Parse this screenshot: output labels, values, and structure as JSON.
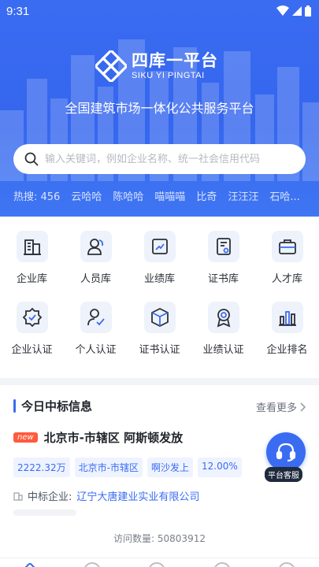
{
  "status_bar": {
    "time": "9:31"
  },
  "brand": {
    "name_cn": "四库一平台",
    "name_en": "SIKU YI PINGTAI"
  },
  "tagline": "全国建筑市场一体化公共服务平台",
  "search": {
    "placeholder": "输入关键词，例如企业名称、统一社会信用代码"
  },
  "hot_search": {
    "label": "热搜: 456",
    "items": [
      "云哈哈",
      "陈哈哈",
      "喵喵喵",
      "比奇",
      "汪汪汪",
      "石哈..."
    ]
  },
  "grid": [
    {
      "label": "企业库",
      "icon": "building-icon"
    },
    {
      "label": "人员库",
      "icon": "people-icon"
    },
    {
      "label": "业绩库",
      "icon": "trend-chart-icon"
    },
    {
      "label": "证书库",
      "icon": "certificate-icon"
    },
    {
      "label": "人才库",
      "icon": "briefcase-icon"
    },
    {
      "label": "企业认证",
      "icon": "verified-badge-icon"
    },
    {
      "label": "个人认证",
      "icon": "user-check-icon"
    },
    {
      "label": "证书认证",
      "icon": "cube-icon"
    },
    {
      "label": "业绩认证",
      "icon": "medal-icon"
    },
    {
      "label": "企业排名",
      "icon": "bar-chart-icon"
    }
  ],
  "bid_info": {
    "title": "今日中标信息",
    "see_more": "查看更多",
    "item": {
      "badge": "new",
      "name": "北京市-市辖区 阿斯顿发放",
      "tags": [
        "2222.32万",
        "北京市-市辖区",
        "啊沙发上",
        "12.00%"
      ],
      "winner_label": "中标企业:",
      "winner_company": "辽宁大唐建业实业有限公司"
    },
    "visit_count": "访问数量:  50803912"
  },
  "service": {
    "label": "平台客服"
  },
  "colors": {
    "primary": "#3a6cf2",
    "new_badge": "#ff5a3c",
    "tag_bg": "#eef3ff"
  }
}
